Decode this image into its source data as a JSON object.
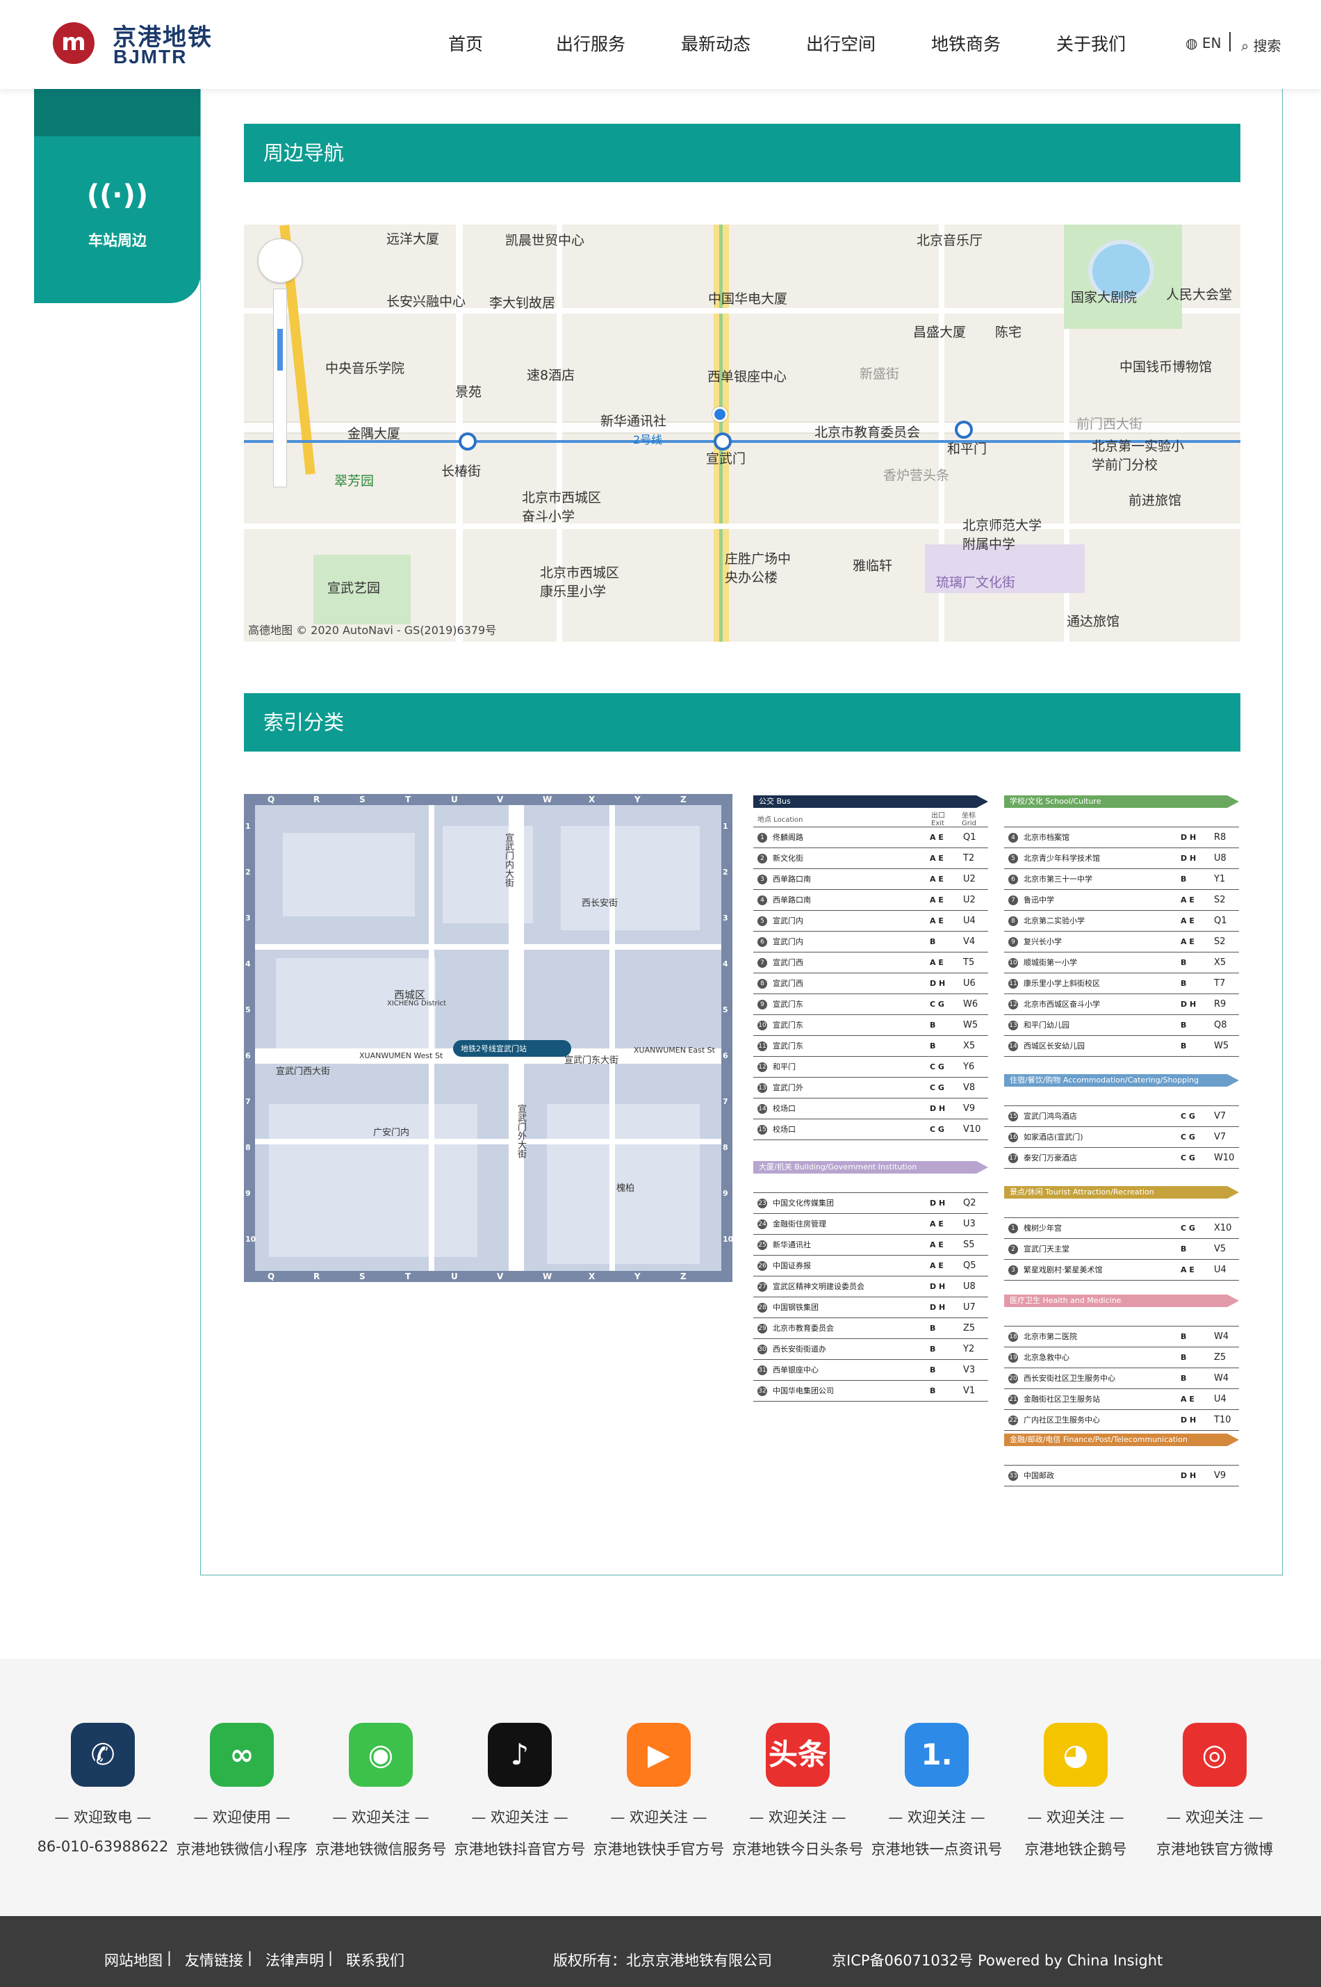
{
  "header": {
    "logo_mark": "m",
    "logo_cn": "京港地铁",
    "logo_en": "BJMTR",
    "nav": [
      "首页",
      "出行服务",
      "最新动态",
      "出行空间",
      "地铁商务",
      "关于我们"
    ],
    "lang": "EN",
    "search": "搜索"
  },
  "sidebar": {
    "icon": "((·))",
    "label": "车站周边"
  },
  "section1": {
    "title": "周边导航"
  },
  "section2": {
    "title": "索引分类"
  },
  "map": {
    "labels": [
      "远洋大厦",
      "凯晨世贸中心",
      "北京音乐厅",
      "长安兴融中心",
      "李大钊故居",
      "中国华电大厦",
      "国家大剧院",
      "人民大会堂",
      "昌盛大厦",
      "陈宅",
      "中央音乐学院",
      "速8酒店",
      "西单银座中心",
      "新盛街",
      "中国钱币博物馆",
      "景苑",
      "金隅大厦",
      "新华通讯社",
      "北京市教育委员会",
      "前门西大街",
      "宣武门",
      "和平门",
      "北京第一实验小学前门分校",
      "长椿街",
      "翠芳园",
      "北京市西城区奋斗小学",
      "香炉营头条",
      "前进旅馆",
      "北京师范大学附属中学",
      "北京市西城区康乐里小学",
      "庄胜广场中央办公楼",
      "雅临轩",
      "琉璃厂文化街",
      "宣武艺园",
      "通达旅馆",
      "2号线"
    ],
    "attribution": "高德地图 © 2020 AutoNavi - GS(2019)6379号"
  },
  "index_map": {
    "cols": [
      "Q",
      "R",
      "S",
      "T",
      "U",
      "V",
      "W",
      "X",
      "Y",
      "Z"
    ],
    "rows": [
      "1",
      "2",
      "3",
      "4",
      "5",
      "6",
      "7",
      "8",
      "9",
      "10"
    ],
    "labels": [
      "西城区",
      "XICHENG District",
      "宣武门西大街",
      "XUANWUMEN West St",
      "宣武门东大街",
      "XUANWUMEN East St",
      "宣武门内大街",
      "宣武门外大街",
      "地铁2号线宣武门站",
      "西长安街",
      "广安门内",
      "槐柏"
    ]
  },
  "bus_table": {
    "title": "公交 Bus",
    "col_location": "地点 Location",
    "col_exit": "出口 Exit",
    "col_grid": "坐标 Grid",
    "rows": [
      {
        "n": "1",
        "name": "佟麟阁路",
        "exit": "A E",
        "grid": "Q1"
      },
      {
        "n": "2",
        "name": "新文化街",
        "exit": "A E",
        "grid": "T2"
      },
      {
        "n": "3",
        "name": "西单路口南",
        "exit": "A E",
        "grid": "U2"
      },
      {
        "n": "4",
        "name": "西单路口南",
        "exit": "A E",
        "grid": "U2"
      },
      {
        "n": "5",
        "name": "宣武门内",
        "exit": "A E",
        "grid": "U4"
      },
      {
        "n": "6",
        "name": "宣武门内",
        "exit": "B",
        "grid": "V4"
      },
      {
        "n": "7",
        "name": "宣武门西",
        "exit": "A E",
        "grid": "T5"
      },
      {
        "n": "8",
        "name": "宣武门西",
        "exit": "D H",
        "grid": "U6"
      },
      {
        "n": "9",
        "name": "宣武门东",
        "exit": "C G",
        "grid": "W6"
      },
      {
        "n": "10",
        "name": "宣武门东",
        "exit": "B",
        "grid": "W5"
      },
      {
        "n": "11",
        "name": "宣武门东",
        "exit": "B",
        "grid": "X5"
      },
      {
        "n": "12",
        "name": "和平门",
        "exit": "C G",
        "grid": "Y6"
      },
      {
        "n": "13",
        "name": "宣武门外",
        "exit": "C G",
        "grid": "V8"
      },
      {
        "n": "14",
        "name": "校场口",
        "exit": "D H",
        "grid": "V9"
      },
      {
        "n": "15",
        "name": "校场口",
        "exit": "C G",
        "grid": "V10"
      }
    ]
  },
  "gov_table": {
    "title": "大厦/机关 Building/Government Institution",
    "rows": [
      {
        "n": "23",
        "name": "中国文化传媒集团",
        "exit": "D H",
        "grid": "Q2"
      },
      {
        "n": "24",
        "name": "金融街住房管理",
        "exit": "A E",
        "grid": "U3"
      },
      {
        "n": "25",
        "name": "新华通讯社",
        "exit": "A E",
        "grid": "S5"
      },
      {
        "n": "26",
        "name": "中国证券报",
        "exit": "A E",
        "grid": "Q5"
      },
      {
        "n": "27",
        "name": "宣武区精神文明建设委员会",
        "exit": "D H",
        "grid": "U8"
      },
      {
        "n": "28",
        "name": "中国钢铁集团",
        "exit": "D H",
        "grid": "U7"
      },
      {
        "n": "29",
        "name": "北京市教育委员会",
        "exit": "B",
        "grid": "Z5"
      },
      {
        "n": "30",
        "name": "西长安街街道办",
        "exit": "B",
        "grid": "Y2"
      },
      {
        "n": "31",
        "name": "西单银座中心",
        "exit": "B",
        "grid": "V3"
      },
      {
        "n": "32",
        "name": "中国华电集团公司",
        "exit": "B",
        "grid": "V1"
      }
    ]
  },
  "school_table": {
    "title": "学校/文化 School/Culture",
    "rows": [
      {
        "n": "4",
        "name": "北京市档案馆",
        "exit": "D H",
        "grid": "R8"
      },
      {
        "n": "5",
        "name": "北京青少年科学技术馆",
        "exit": "D H",
        "grid": "U8"
      },
      {
        "n": "6",
        "name": "北京市第三十一中学",
        "exit": "B",
        "grid": "Y1"
      },
      {
        "n": "7",
        "name": "鲁迅中学",
        "exit": "A E",
        "grid": "S2"
      },
      {
        "n": "8",
        "name": "北京第二实验小学",
        "exit": "A E",
        "grid": "Q1"
      },
      {
        "n": "9",
        "name": "复兴长小学",
        "exit": "A E",
        "grid": "S2"
      },
      {
        "n": "10",
        "name": "顺城街第一小学",
        "exit": "B",
        "grid": "X5"
      },
      {
        "n": "11",
        "name": "康乐里小学上斜街校区",
        "exit": "B",
        "grid": "T7"
      },
      {
        "n": "12",
        "name": "北京市西城区奋斗小学",
        "exit": "D H",
        "grid": "R9"
      },
      {
        "n": "13",
        "name": "和平门幼儿园",
        "exit": "B",
        "grid": "Q8"
      },
      {
        "n": "14",
        "name": "西城区长安幼儿园",
        "exit": "B",
        "grid": "W5"
      }
    ]
  },
  "hotel_table": {
    "title": "住宿/餐饮/购物 Accommodation/Catering/Shopping",
    "rows": [
      {
        "n": "15",
        "name": "宣武门鸿鸟酒店",
        "exit": "C G",
        "grid": "V7"
      },
      {
        "n": "16",
        "name": "如家酒店(宣武门)",
        "exit": "C G",
        "grid": "V7"
      },
      {
        "n": "17",
        "name": "泰安门万豪酒店",
        "exit": "C G",
        "grid": "W10"
      }
    ]
  },
  "tour_table": {
    "title": "景点/休闲 Tourist Attraction/Recreation",
    "rows": [
      {
        "n": "1",
        "name": "槐树少年宫",
        "exit": "C G",
        "grid": "X10"
      },
      {
        "n": "2",
        "name": "宣武门天主堂",
        "exit": "B",
        "grid": "V5"
      },
      {
        "n": "3",
        "name": "繁星戏剧村·繁星美术馆",
        "exit": "A E",
        "grid": "U4"
      }
    ]
  },
  "health_table": {
    "title": "医疗卫生 Health and Medicine",
    "rows": [
      {
        "n": "18",
        "name": "北京市第二医院",
        "exit": "B",
        "grid": "W4"
      },
      {
        "n": "19",
        "name": "北京急救中心",
        "exit": "B",
        "grid": "Z5"
      },
      {
        "n": "20",
        "name": "西长安街社区卫生服务中心",
        "exit": "B",
        "grid": "W4"
      },
      {
        "n": "21",
        "name": "金融街社区卫生服务站",
        "exit": "A E",
        "grid": "U4"
      },
      {
        "n": "22",
        "name": "广内社区卫生服务中心",
        "exit": "D H",
        "grid": "T10"
      }
    ]
  },
  "post_table": {
    "title": "金融/邮政/电信 Finance/Post/Telecommunication",
    "rows": [
      {
        "n": "33",
        "name": "中国邮政",
        "exit": "D H",
        "grid": "V9"
      }
    ]
  },
  "footer": {
    "items": [
      {
        "line1": "— 欢迎致电 —",
        "line2": "86-010-63988622",
        "icon": "phone-icon",
        "color": "#1b3a5f"
      },
      {
        "line1": "— 欢迎使用 —",
        "line2": "京港地铁微信小程序",
        "icon": "mini-program-icon",
        "color": "#2db24a"
      },
      {
        "line1": "— 欢迎关注 —",
        "line2": "京港地铁微信服务号",
        "icon": "wechat-icon",
        "color": "#3cc14a"
      },
      {
        "line1": "— 欢迎关注 —",
        "line2": "京港地铁抖音官方号",
        "icon": "douyin-icon",
        "color": "#111111"
      },
      {
        "line1": "— 欢迎关注 —",
        "line2": "京港地铁快手官方号",
        "icon": "kuaishou-icon",
        "color": "#ff7a1a"
      },
      {
        "line1": "— 欢迎关注 —",
        "line2": "京港地铁今日头条号",
        "icon": "toutiao-icon",
        "color": "#e8302f"
      },
      {
        "line1": "— 欢迎关注 —",
        "line2": "京港地铁一点资讯号",
        "icon": "yidian-icon",
        "color": "#2d8ae6"
      },
      {
        "line1": "— 欢迎关注 —",
        "line2": "京港地铁企鹅号",
        "icon": "penguin-icon",
        "color": "#f5c400"
      },
      {
        "line1": "— 欢迎关注 —",
        "line2": "京港地铁官方微博",
        "icon": "weibo-icon",
        "color": "#e8312f"
      }
    ],
    "glyphs": [
      "✆",
      "∞",
      "◉",
      "♪",
      "▶",
      "头条",
      "1.",
      "◕",
      "◎"
    ]
  },
  "copyright": {
    "links": [
      "网站地图",
      "友情链接",
      "法律声明",
      "联系我们"
    ],
    "owner": "版权所有：北京京港地铁有限公司",
    "icp": "京ICP备06071032号 Powered by China Insight"
  }
}
